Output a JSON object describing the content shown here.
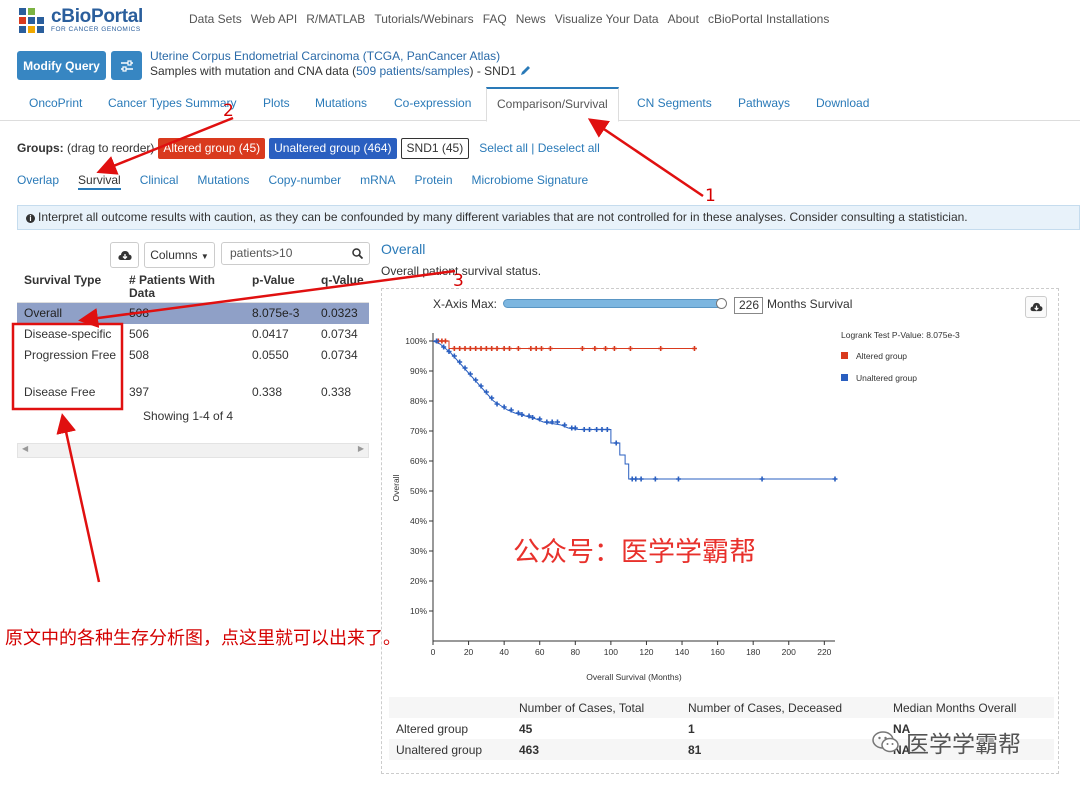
{
  "colors": {
    "brand": "#2a5e9c",
    "link": "#2a7ab8",
    "altered": "#d93a1e",
    "unaltered": "#2a5fc0",
    "annotation": "#d40000"
  },
  "logo": {
    "name": "cBioPortal",
    "sub": "FOR CANCER GENOMICS"
  },
  "topnav": [
    "Data Sets",
    "Web API",
    "R/MATLAB",
    "Tutorials/Webinars",
    "FAQ",
    "News",
    "Visualize Your Data",
    "About",
    "cBioPortal Installations"
  ],
  "query": {
    "modify_label": "Modify Query",
    "settings_icon": "sliders-icon",
    "study_title": "Uterine Corpus Endometrial Carcinoma (TCGA, PanCancer Atlas)",
    "sub_prefix": "Samples with mutation and CNA data (",
    "sub_count": "509 patients/samples",
    "sub_suffix": ")  - SND1",
    "edit_icon": "pencil-icon"
  },
  "tabs": [
    "OncoPrint",
    "Cancer Types Summary",
    "Plots",
    "Mutations",
    "Co-expression",
    "Comparison/Survival",
    "CN Segments",
    "Pathways",
    "Download"
  ],
  "groups": {
    "label": "Groups:",
    "hint": "(drag to reorder)",
    "altered": "Altered group (45)",
    "unaltered": "Unaltered group (464)",
    "gene": "SND1 (45)",
    "select_all": "Select all",
    "separator": "|",
    "deselect_all": "Deselect all"
  },
  "subtabs": [
    "Overlap",
    "Survival",
    "Clinical",
    "Mutations",
    "Copy-number",
    "mRNA",
    "Protein",
    "Microbiome Signature"
  ],
  "caution": "Interpret all outcome results with caution, as they can be confounded by many different variables that are not controlled for in these analyses. Consider consulting a statistician.",
  "table": {
    "columns_label": "Columns",
    "search_value": "patients>10",
    "headers": [
      "Survival Type",
      "# Patients With Data",
      "p-Value",
      "q-Value"
    ],
    "rows": [
      {
        "type": "Overall",
        "n": "508",
        "p": "8.075e-3",
        "q": "0.0323"
      },
      {
        "type": "Disease-specific",
        "n": "506",
        "p": "0.0417",
        "q": "0.0734"
      },
      {
        "type": "Progression Free",
        "n": "508",
        "p": "0.0550",
        "q": "0.0734"
      },
      {
        "type": "Disease Free",
        "n": "397",
        "p": "0.338",
        "q": "0.338"
      }
    ],
    "showing": "Showing 1-4 of 4"
  },
  "plot": {
    "title": "Overall",
    "description": "Overall patient survival status.",
    "xmax_label": "X-Axis Max:",
    "xmax_value": "226",
    "xmax_units": "Months Survival",
    "logrank": "Logrank Test P-Value: 8.075e-3"
  },
  "chart_data": {
    "type": "line",
    "title": "",
    "xlabel": "Overall Survival (Months)",
    "ylabel": "Overall",
    "xlim": [
      0,
      226
    ],
    "ylim": [
      0,
      100
    ],
    "xticks": [
      0,
      20,
      40,
      60,
      80,
      100,
      120,
      140,
      160,
      180,
      200,
      220
    ],
    "yticks": [
      10,
      20,
      30,
      40,
      50,
      60,
      70,
      80,
      90,
      100
    ],
    "legend_position": "top-right",
    "series": [
      {
        "name": "Altered group",
        "color": "#d93a1e",
        "steps": [
          [
            0,
            100
          ],
          [
            9,
            100
          ],
          [
            9,
            97.5
          ],
          [
            147,
            97.5
          ]
        ],
        "censored": [
          [
            3,
            100
          ],
          [
            5,
            100
          ],
          [
            7,
            100
          ],
          [
            12,
            97.5
          ],
          [
            15,
            97.5
          ],
          [
            18,
            97.5
          ],
          [
            21,
            97.5
          ],
          [
            24,
            97.5
          ],
          [
            27,
            97.5
          ],
          [
            30,
            97.5
          ],
          [
            33,
            97.5
          ],
          [
            36,
            97.5
          ],
          [
            40,
            97.5
          ],
          [
            43,
            97.5
          ],
          [
            48,
            97.5
          ],
          [
            55,
            97.5
          ],
          [
            58,
            97.5
          ],
          [
            61,
            97.5
          ],
          [
            66,
            97.5
          ],
          [
            84,
            97.5
          ],
          [
            91,
            97.5
          ],
          [
            97,
            97.5
          ],
          [
            102,
            97.5
          ],
          [
            111,
            97.5
          ],
          [
            128,
            97.5
          ],
          [
            147,
            97.5
          ]
        ]
      },
      {
        "name": "Unaltered group",
        "color": "#2a5fc0",
        "steps": [
          [
            0,
            100
          ],
          [
            4,
            99
          ],
          [
            7,
            97.5
          ],
          [
            10,
            96
          ],
          [
            13,
            94
          ],
          [
            16,
            92
          ],
          [
            19,
            90
          ],
          [
            22,
            88
          ],
          [
            25,
            86
          ],
          [
            28,
            84
          ],
          [
            31,
            82
          ],
          [
            34,
            80
          ],
          [
            38,
            78.5
          ],
          [
            42,
            77
          ],
          [
            46,
            76
          ],
          [
            52,
            75
          ],
          [
            58,
            74
          ],
          [
            62,
            73
          ],
          [
            72,
            72
          ],
          [
            76,
            71
          ],
          [
            82,
            70.5
          ],
          [
            100,
            70.5
          ],
          [
            100,
            66
          ],
          [
            105,
            66
          ],
          [
            105,
            62
          ],
          [
            108,
            62
          ],
          [
            108,
            59
          ],
          [
            110,
            59
          ],
          [
            110,
            54
          ],
          [
            226,
            54
          ]
        ],
        "censored": [
          [
            2,
            100
          ],
          [
            6,
            98
          ],
          [
            9,
            96.5
          ],
          [
            12,
            95
          ],
          [
            15,
            93
          ],
          [
            18,
            91
          ],
          [
            21,
            89
          ],
          [
            24,
            87
          ],
          [
            27,
            85
          ],
          [
            30,
            83
          ],
          [
            33,
            81
          ],
          [
            36,
            79
          ],
          [
            40,
            78
          ],
          [
            44,
            77
          ],
          [
            48,
            76
          ],
          [
            50,
            75.5
          ],
          [
            54,
            75
          ],
          [
            56,
            74.5
          ],
          [
            60,
            74
          ],
          [
            64,
            73
          ],
          [
            67,
            73
          ],
          [
            70,
            73
          ],
          [
            74,
            72
          ],
          [
            78,
            71
          ],
          [
            80,
            71
          ],
          [
            85,
            70.5
          ],
          [
            88,
            70.5
          ],
          [
            92,
            70.5
          ],
          [
            95,
            70.5
          ],
          [
            98,
            70.5
          ],
          [
            103,
            66
          ],
          [
            112,
            54
          ],
          [
            114,
            54
          ],
          [
            117,
            54
          ],
          [
            125,
            54
          ],
          [
            138,
            54
          ],
          [
            185,
            54
          ],
          [
            226,
            54
          ]
        ]
      }
    ]
  },
  "summary": {
    "headers": [
      "Number of Cases, Total",
      "Number of Cases, Deceased",
      "Median Months Overall"
    ],
    "rows": [
      {
        "group": "Altered group",
        "total": "45",
        "deceased": "1",
        "median": "NA"
      },
      {
        "group": "Unaltered group",
        "total": "463",
        "deceased": "81",
        "median": "NA"
      }
    ]
  },
  "annotations": {
    "note": "原文中的各种生存分析图，点这里就可以出来了。",
    "watermark": "公众号：医学学霸帮",
    "wechat": "医学学霸帮",
    "label1": "1",
    "label2": "2",
    "label3": "3"
  }
}
